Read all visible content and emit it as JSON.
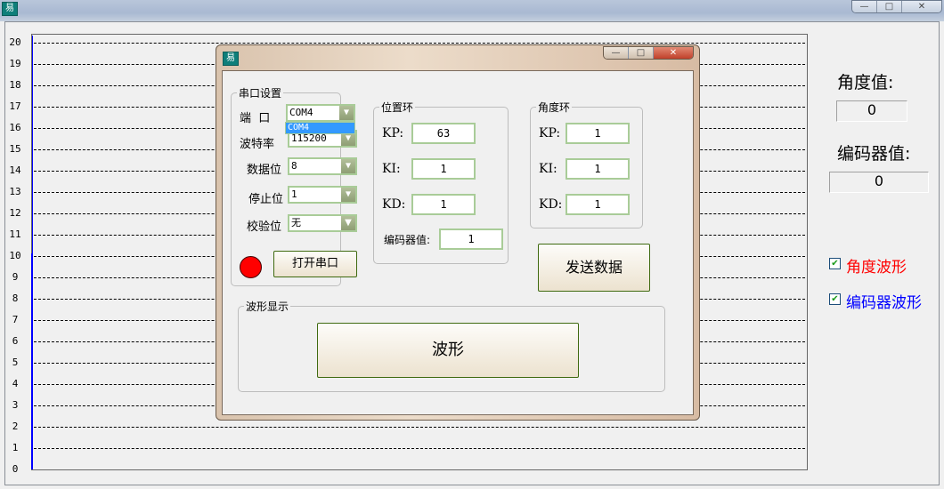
{
  "window": {
    "icon": "app-icon",
    "controls": {
      "minimize": "—",
      "maximize": "□",
      "close": "✕"
    }
  },
  "plot": {
    "y_ticks": [
      "0",
      "1",
      "2",
      "3",
      "4",
      "5",
      "6",
      "7",
      "8",
      "9",
      "10",
      "11",
      "12",
      "13",
      "14",
      "15",
      "16",
      "17",
      "18",
      "19",
      "20"
    ],
    "ylim": [
      0,
      20
    ],
    "series_color": "#0000ff"
  },
  "dialog": {
    "controls": {
      "minimize": "—",
      "maximize": "□",
      "close": "✕"
    },
    "serial": {
      "title": "串口设置",
      "port_label": "端  口",
      "port_value": "COM4",
      "port_dropdown_option": "COM4",
      "baud_label": "波特率",
      "baud_value": "115200",
      "data_label": "数据位",
      "data_value": "8",
      "stop_label": "停止位",
      "stop_value": "1",
      "parity_label": "校验位",
      "parity_value": "无",
      "status_color": "#ff0000",
      "open_button": "打开串口"
    },
    "position_loop": {
      "title": "位置环",
      "kp_label": "KP:",
      "kp": "63",
      "ki_label": "KI:",
      "ki": "1",
      "kd_label": "KD:",
      "kd": "1",
      "encoder_label": "编码器值:",
      "encoder": "1"
    },
    "angle_loop": {
      "title": "角度环",
      "kp_label": "KP:",
      "kp": "1",
      "ki_label": "KI:",
      "ki": "1",
      "kd_label": "KD:",
      "kd": "1"
    },
    "send_button": "发送数据",
    "waveform": {
      "title": "波形显示",
      "button": "波形"
    }
  },
  "side": {
    "angle_label": "角度值:",
    "angle_value": "0",
    "encoder_label": "编码器值:",
    "encoder_value": "0",
    "angle_wave": {
      "label": "角度波形",
      "checked": true,
      "color": "#ff0000"
    },
    "encoder_wave": {
      "label": "编码器波形",
      "checked": true,
      "color": "#0000ff"
    }
  }
}
